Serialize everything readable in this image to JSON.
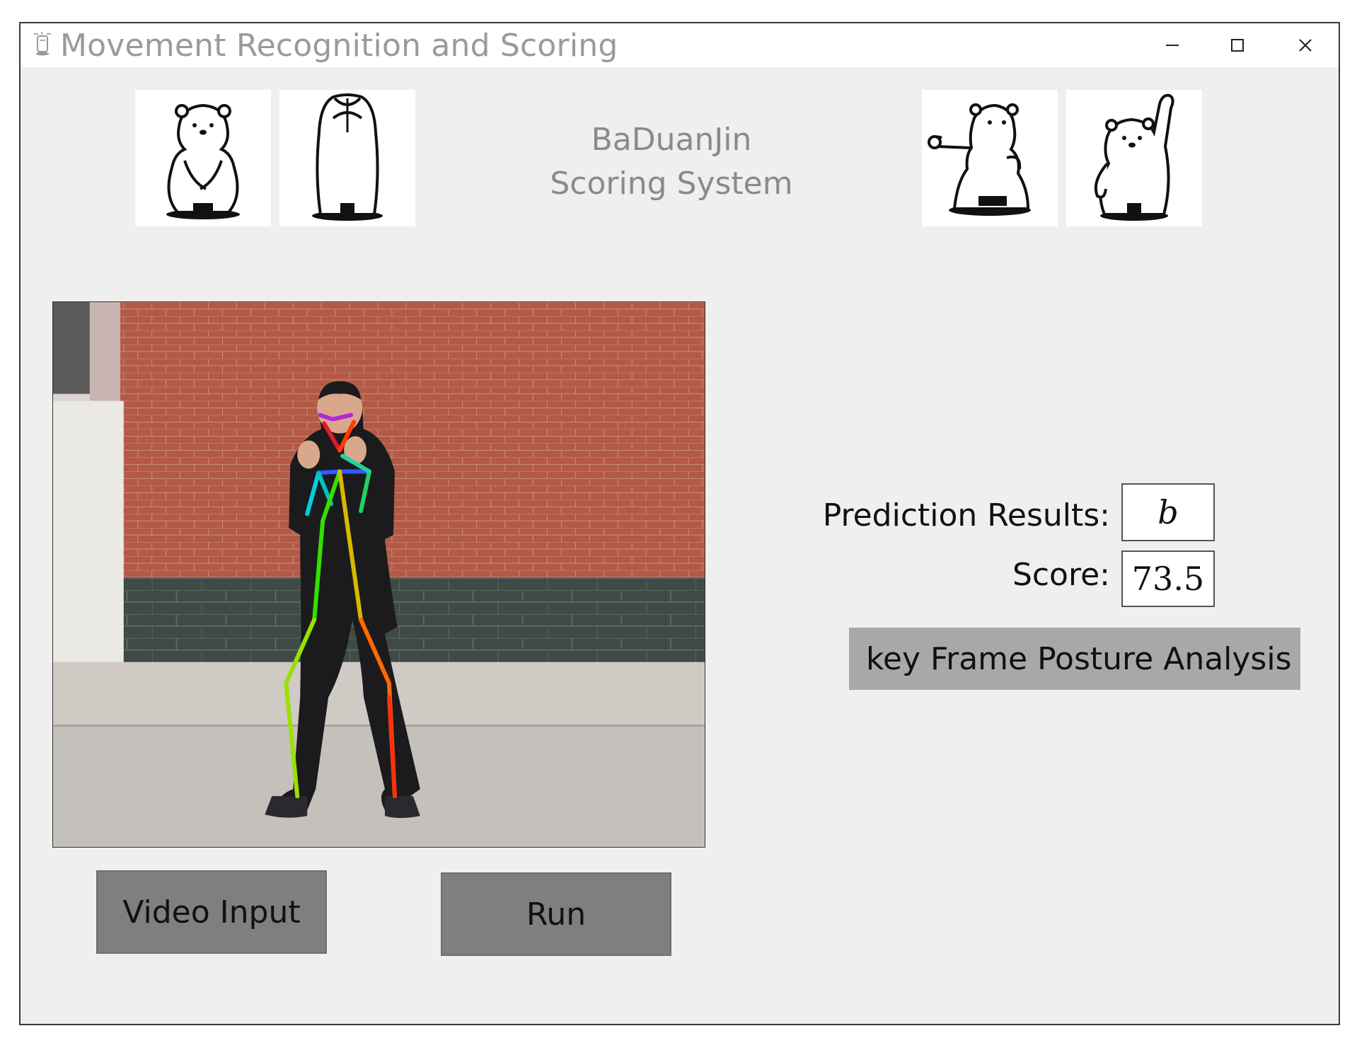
{
  "window": {
    "title": "Movement Recognition and Scoring",
    "controls": {
      "minimize_icon": "minimize-icon",
      "maximize_icon": "maximize-icon",
      "close_icon": "close-icon"
    }
  },
  "header": {
    "title_line1": "BaDuanJin",
    "title_line2": "Scoring System",
    "pose_images": [
      "bear-standing-arms-crossed",
      "bear-arms-raised-overhead",
      "bear-drawing-bow-stance",
      "bear-one-arm-raised"
    ]
  },
  "video": {
    "description_icon": "pose-skeleton-video-frame"
  },
  "buttons": {
    "video_input": "Video Input",
    "run": "Run",
    "key_frame": "key Frame Posture Analysis"
  },
  "results": {
    "prediction_label": "Prediction Results:",
    "prediction_value": "b",
    "score_label": "Score:",
    "score_value": "73.5"
  },
  "colors": {
    "window_bg": "#efefef",
    "button_gray": "#7f7f7f",
    "button_light_gray": "#a8a8a8",
    "title_text": "#9a9a9a"
  }
}
